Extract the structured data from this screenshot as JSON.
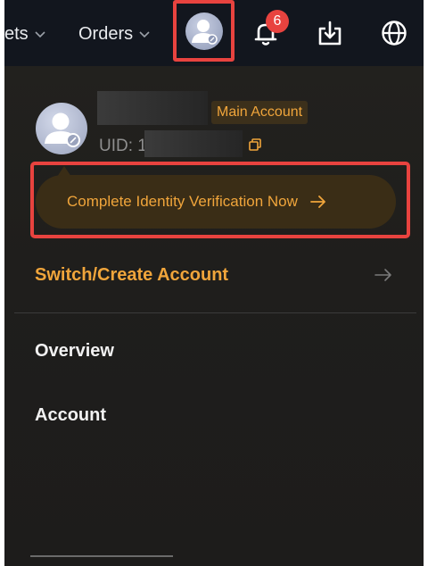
{
  "topbar": {
    "nav_partial_label": "ets",
    "orders_label": "Orders",
    "notification_count": "6"
  },
  "account": {
    "badge": "Main Account",
    "uid_label": "UID: 1"
  },
  "verify": {
    "label": "Complete Identity Verification Now"
  },
  "menu": {
    "switch_label": "Switch/Create Account",
    "overview_label": "Overview",
    "account_label": "Account"
  },
  "colors": {
    "accent": "#f0a53b",
    "highlight": "#e8433f",
    "background": "#1c1b19",
    "topbar": "#12161e"
  },
  "icons": [
    "chevron-down-icon",
    "user-avatar-icon",
    "bell-icon",
    "download-icon",
    "globe-icon",
    "copy-icon",
    "arrow-right-icon"
  ]
}
